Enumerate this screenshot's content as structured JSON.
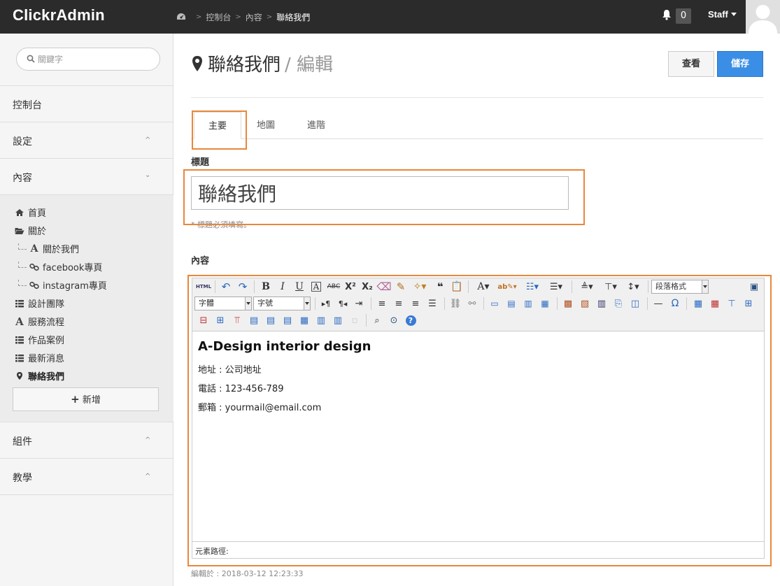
{
  "app": {
    "brand": "ClickrAdmin"
  },
  "breadcrumb": [
    "控制台",
    "內容",
    "聯絡我們"
  ],
  "header": {
    "notif_count": "0",
    "user": "Staff"
  },
  "sidebar": {
    "search_placeholder": "關鍵字",
    "dashboard": "控制台",
    "settings": "設定",
    "content": "內容",
    "components": "組件",
    "tutorial": "教學",
    "pages": [
      {
        "label": "首頁",
        "icon": "home-icon"
      },
      {
        "label": "關於",
        "icon": "folder-open-icon"
      },
      {
        "label": "關於我們",
        "icon": "font-icon"
      },
      {
        "label": "facebook專頁",
        "icon": "link-icon"
      },
      {
        "label": "instagram專頁",
        "icon": "link-icon"
      },
      {
        "label": "設計團隊",
        "icon": "list-icon"
      },
      {
        "label": "服務流程",
        "icon": "font-icon"
      },
      {
        "label": "作品案例",
        "icon": "list-icon"
      },
      {
        "label": "最新消息",
        "icon": "list-icon"
      },
      {
        "label": "聯絡我們",
        "icon": "map-marker-icon"
      }
    ],
    "add_label": "新增"
  },
  "page": {
    "title": "聯絡我們",
    "subtitle": "/ 編輯",
    "view_label": "查看",
    "save_label": "儲存"
  },
  "tabs": [
    "主要",
    "地圖",
    "進階"
  ],
  "form": {
    "title_label": "標題",
    "title_value": "聯絡我們",
    "title_hint": "* 標題必須填寫。",
    "content_label": "內容"
  },
  "editor": {
    "toolbar_html": "HTML",
    "font_family": "字體",
    "font_size": "字號",
    "paragraph_format": "段落格式",
    "body_heading": "A-Design interior design",
    "body_lines": [
      "地址 : 公司地址",
      "電話 : 123-456-789",
      "郵箱 : yourmail@email.com"
    ],
    "path_label": "元素路徑:"
  },
  "footer": {
    "edited_at": "編輯於 : 2018-03-12 12:23:33"
  },
  "colors": {
    "topbar": "#2b2b2b",
    "primary": "#3a8ee6",
    "highlight": "#e8873a"
  }
}
